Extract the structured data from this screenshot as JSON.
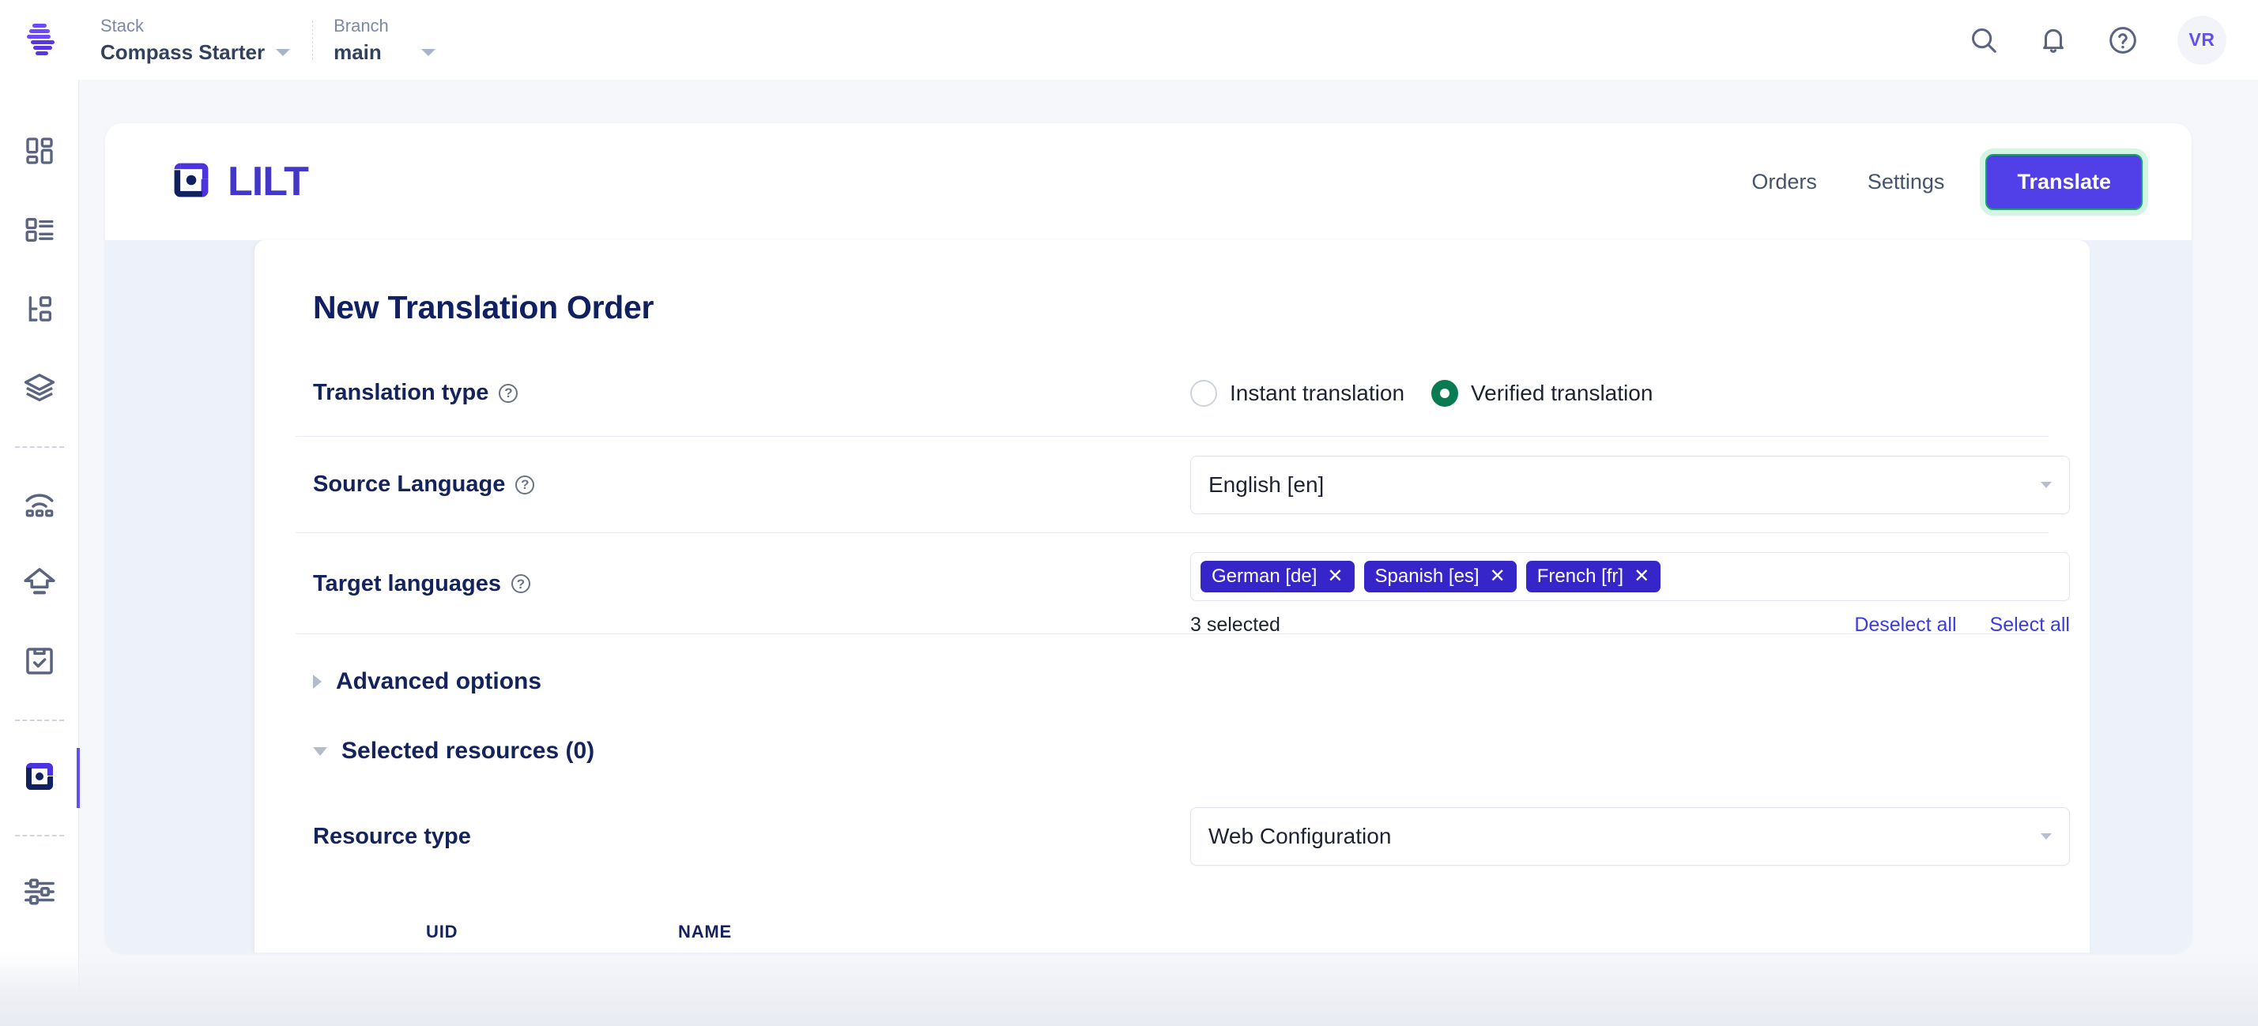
{
  "topbar": {
    "logo_icon": "contentstack-logo-icon",
    "context": [
      {
        "label": "Stack",
        "value": "Compass Starter",
        "icon": "chevron-down-icon"
      },
      {
        "label": "Branch",
        "value": "main",
        "icon": "chevron-down-icon"
      }
    ],
    "actions": [
      {
        "name": "search-icon",
        "title": "Search"
      },
      {
        "name": "bell-icon",
        "title": "Notifications"
      },
      {
        "name": "question-circle-icon",
        "title": "Help"
      }
    ],
    "avatar_initials": "VR"
  },
  "rail": {
    "items": [
      {
        "name": "dashboard-icon",
        "active": false
      },
      {
        "name": "content-types-icon",
        "active": false
      },
      {
        "name": "hierarchy-icon",
        "active": false
      },
      {
        "name": "stacks-layers-icon",
        "active": false
      },
      {
        "name": "divider",
        "active": false
      },
      {
        "name": "live-preview-icon",
        "active": false
      },
      {
        "name": "publish-upload-icon",
        "active": false
      },
      {
        "name": "tasks-clipboard-icon",
        "active": false
      },
      {
        "name": "divider",
        "active": false
      },
      {
        "name": "lilt-app-icon",
        "active": true
      },
      {
        "name": "divider",
        "active": false
      },
      {
        "name": "settings-sliders-icon",
        "active": false
      }
    ]
  },
  "app": {
    "brand": "LILT",
    "brand_icon": "lilt-logo-icon",
    "nav": [
      {
        "label": "Orders"
      },
      {
        "label": "Settings"
      }
    ],
    "primary_button": "Translate",
    "primary_button_color": "#5140e8",
    "primary_button_focus_ring": "#13a46a"
  },
  "form": {
    "title": "New Translation Order",
    "translation_type": {
      "label": "Translation type",
      "help_icon": "question-circle-icon",
      "options": [
        {
          "label": "Instant translation",
          "selected": false
        },
        {
          "label": "Verified translation",
          "selected": true
        }
      ],
      "selected_color": "#0a7a52"
    },
    "source_language": {
      "label": "Source Language",
      "help_icon": "question-circle-icon",
      "value": "English [en]",
      "caret_icon": "chevron-down-icon"
    },
    "target_languages": {
      "label": "Target languages",
      "help_icon": "question-circle-icon",
      "chips": [
        {
          "label": "German [de]",
          "remove_icon": "close-icon"
        },
        {
          "label": "Spanish [es]",
          "remove_icon": "close-icon"
        },
        {
          "label": "French [fr]",
          "remove_icon": "close-icon"
        }
      ],
      "count_text": "3 selected",
      "deselect_all": "Deselect all",
      "select_all": "Select all",
      "chip_color": "#3626c9"
    },
    "advanced_options": {
      "label": "Advanced options",
      "expanded": false,
      "toggle_icon": "triangle-right-icon"
    },
    "selected_resources": {
      "label": "Selected resources (0)",
      "expanded": true,
      "toggle_icon": "triangle-down-icon"
    },
    "resource_type": {
      "label": "Resource type",
      "value": "Web Configuration",
      "caret_icon": "chevron-down-icon"
    },
    "resource_table": {
      "columns": [
        "UID",
        "NAME"
      ]
    }
  }
}
